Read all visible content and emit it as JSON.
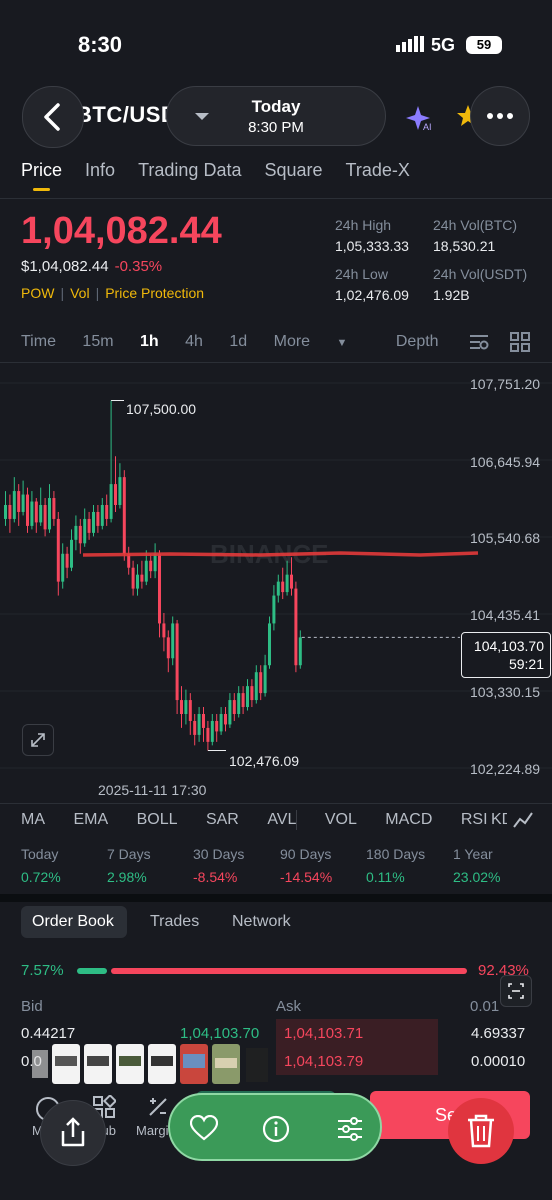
{
  "status_bar": {
    "time": "8:30",
    "network": "5G",
    "battery": "59"
  },
  "header": {
    "pair": "BTC/USDT",
    "today_title": "Today",
    "today_time": "8:30 PM"
  },
  "tabs": [
    "Price",
    "Info",
    "Trading Data",
    "Square",
    "Trade-X"
  ],
  "price": {
    "last": "1,04,082.44",
    "usd": "$1,04,082.44",
    "change": "-0.35%",
    "tags": [
      "POW",
      "Vol",
      "Price Protection"
    ]
  },
  "stats": {
    "high_label": "24h High",
    "high": "1,05,333.33",
    "vol_btc_label": "24h Vol(BTC)",
    "vol_btc": "18,530.21",
    "low_label": "24h Low",
    "low": "1,02,476.09",
    "vol_usdt_label": "24h Vol(USDT)",
    "vol_usdt": "1.92B"
  },
  "intervals": [
    "Time",
    "15m",
    "1h",
    "4h",
    "1d",
    "More",
    "Depth"
  ],
  "chart_data": {
    "type": "candlestick",
    "y_ticks": [
      "107,751.20",
      "106,645.94",
      "105,540.68",
      "104,435.41",
      "103,330.15",
      "102,224.89"
    ],
    "ylim": [
      102224.89,
      107751.2
    ],
    "high_marker": "107,500.00",
    "low_marker": "102,476.09",
    "current_price": "104,103.70",
    "countdown": "59:21",
    "x_label": "2025-11-11 17:30",
    "watermark": "BINANCE",
    "candles": [
      {
        "o": 105800,
        "c": 106000,
        "h": 106200,
        "l": 105700
      },
      {
        "o": 106000,
        "c": 105800,
        "h": 106150,
        "l": 105600
      },
      {
        "o": 105800,
        "c": 106200,
        "h": 106400,
        "l": 105750
      },
      {
        "o": 106200,
        "c": 105900,
        "h": 106300,
        "l": 105700
      },
      {
        "o": 105900,
        "c": 106150,
        "h": 106350,
        "l": 105850
      },
      {
        "o": 106150,
        "c": 105700,
        "h": 106250,
        "l": 105600
      },
      {
        "o": 105700,
        "c": 106050,
        "h": 106200,
        "l": 105650
      },
      {
        "o": 106050,
        "c": 105750,
        "h": 106100,
        "l": 105600
      },
      {
        "o": 105750,
        "c": 106000,
        "h": 106250,
        "l": 105700
      },
      {
        "o": 106000,
        "c": 105650,
        "h": 106100,
        "l": 105550
      },
      {
        "o": 105650,
        "c": 106100,
        "h": 106300,
        "l": 105600
      },
      {
        "o": 106100,
        "c": 105800,
        "h": 106200,
        "l": 105700
      },
      {
        "o": 105800,
        "c": 104900,
        "h": 105900,
        "l": 104700
      },
      {
        "o": 104900,
        "c": 105300,
        "h": 105450,
        "l": 104800
      },
      {
        "o": 105300,
        "c": 105100,
        "h": 105400,
        "l": 104950
      },
      {
        "o": 105100,
        "c": 105500,
        "h": 105650,
        "l": 105050
      },
      {
        "o": 105500,
        "c": 105700,
        "h": 105850,
        "l": 105350
      },
      {
        "o": 105700,
        "c": 105450,
        "h": 105800,
        "l": 105300
      },
      {
        "o": 105450,
        "c": 105800,
        "h": 105950,
        "l": 105400
      },
      {
        "o": 105800,
        "c": 105600,
        "h": 105900,
        "l": 105500
      },
      {
        "o": 105600,
        "c": 105900,
        "h": 106000,
        "l": 105550
      },
      {
        "o": 105900,
        "c": 105700,
        "h": 106000,
        "l": 105600
      },
      {
        "o": 105700,
        "c": 106000,
        "h": 106100,
        "l": 105650
      },
      {
        "o": 106000,
        "c": 105800,
        "h": 106150,
        "l": 105700
      },
      {
        "o": 105800,
        "c": 106300,
        "h": 107500,
        "l": 105750
      },
      {
        "o": 106300,
        "c": 106000,
        "h": 106700,
        "l": 105900
      },
      {
        "o": 106000,
        "c": 106400,
        "h": 106600,
        "l": 105950
      },
      {
        "o": 106400,
        "c": 105300,
        "h": 106500,
        "l": 105200
      },
      {
        "o": 105300,
        "c": 105100,
        "h": 105400,
        "l": 105000
      },
      {
        "o": 105100,
        "c": 104800,
        "h": 105200,
        "l": 104700
      },
      {
        "o": 104800,
        "c": 105000,
        "h": 105150,
        "l": 104700
      },
      {
        "o": 105000,
        "c": 104900,
        "h": 105200,
        "l": 104800
      },
      {
        "o": 104900,
        "c": 105200,
        "h": 105350,
        "l": 104850
      },
      {
        "o": 105200,
        "c": 105050,
        "h": 105300,
        "l": 104950
      },
      {
        "o": 105050,
        "c": 105300,
        "h": 105450,
        "l": 104950
      },
      {
        "o": 105300,
        "c": 104300,
        "h": 105350,
        "l": 104100
      },
      {
        "o": 104300,
        "c": 104100,
        "h": 104450,
        "l": 103900
      },
      {
        "o": 104100,
        "c": 103800,
        "h": 104200,
        "l": 103600
      },
      {
        "o": 103800,
        "c": 104300,
        "h": 104400,
        "l": 103700
      },
      {
        "o": 104300,
        "c": 103200,
        "h": 104350,
        "l": 103000
      },
      {
        "o": 103200,
        "c": 103000,
        "h": 103400,
        "l": 102800
      },
      {
        "o": 103000,
        "c": 103200,
        "h": 103350,
        "l": 102850
      },
      {
        "o": 103200,
        "c": 102900,
        "h": 103300,
        "l": 102700
      },
      {
        "o": 102900,
        "c": 102700,
        "h": 103000,
        "l": 102550
      },
      {
        "o": 102700,
        "c": 103000,
        "h": 103100,
        "l": 102600
      },
      {
        "o": 103000,
        "c": 102800,
        "h": 103100,
        "l": 102600
      },
      {
        "o": 102800,
        "c": 102600,
        "h": 102900,
        "l": 102476
      },
      {
        "o": 102600,
        "c": 102900,
        "h": 103000,
        "l": 102550
      },
      {
        "o": 102900,
        "c": 102750,
        "h": 103000,
        "l": 102600
      },
      {
        "o": 102750,
        "c": 103000,
        "h": 103100,
        "l": 102700
      },
      {
        "o": 103000,
        "c": 102850,
        "h": 103100,
        "l": 102750
      },
      {
        "o": 102850,
        "c": 103200,
        "h": 103300,
        "l": 102800
      },
      {
        "o": 103200,
        "c": 103000,
        "h": 103300,
        "l": 102900
      },
      {
        "o": 103000,
        "c": 103300,
        "h": 103400,
        "l": 102950
      },
      {
        "o": 103300,
        "c": 103100,
        "h": 103400,
        "l": 103000
      },
      {
        "o": 103100,
        "c": 103400,
        "h": 103500,
        "l": 103050
      },
      {
        "o": 103400,
        "c": 103200,
        "h": 103500,
        "l": 103100
      },
      {
        "o": 103200,
        "c": 103600,
        "h": 103700,
        "l": 103150
      },
      {
        "o": 103600,
        "c": 103300,
        "h": 103700,
        "l": 103200
      },
      {
        "o": 103300,
        "c": 103700,
        "h": 103850,
        "l": 103250
      },
      {
        "o": 103700,
        "c": 104300,
        "h": 104400,
        "l": 103650
      },
      {
        "o": 104300,
        "c": 104700,
        "h": 104850,
        "l": 104200
      },
      {
        "o": 104700,
        "c": 104900,
        "h": 105000,
        "l": 104600
      },
      {
        "o": 104900,
        "c": 104750,
        "h": 105100,
        "l": 104650
      },
      {
        "o": 104750,
        "c": 105000,
        "h": 105200,
        "l": 104700
      },
      {
        "o": 105000,
        "c": 104800,
        "h": 105250,
        "l": 104700
      },
      {
        "o": 104800,
        "c": 103700,
        "h": 104900,
        "l": 103600
      },
      {
        "o": 103700,
        "c": 104100,
        "h": 104200,
        "l": 103650
      }
    ]
  },
  "indicators": [
    "MA",
    "EMA",
    "BOLL",
    "SAR",
    "AVL",
    "VOL",
    "MACD",
    "RSI",
    "KDJ"
  ],
  "performance": [
    {
      "label": "Today",
      "value": "0.72%",
      "dir": "pos"
    },
    {
      "label": "7 Days",
      "value": "2.98%",
      "dir": "pos"
    },
    {
      "label": "30 Days",
      "value": "-8.54%",
      "dir": "neg"
    },
    {
      "label": "90 Days",
      "value": "-14.54%",
      "dir": "neg"
    },
    {
      "label": "180 Days",
      "value": "0.11%",
      "dir": "pos"
    },
    {
      "label": "1 Year",
      "value": "23.02%",
      "dir": "pos"
    }
  ],
  "orderbook": {
    "tabs": [
      "Order Book",
      "Trades",
      "Network"
    ],
    "buy_pct": "7.57%",
    "sell_pct": "92.43%",
    "buy_fraction": 0.0757,
    "bid_label": "Bid",
    "ask_label": "Ask",
    "precision": "0.01",
    "rows": [
      {
        "bid_qty": "0.44217",
        "bid_price": "1,04,103.70",
        "ask_price": "1,04,103.71",
        "ask_qty": "4.69337"
      },
      {
        "bid_qty": "0.0",
        "bid_price": "",
        "ask_price": "1,04,103.79",
        "ask_qty": "0.00010"
      }
    ]
  },
  "bottom": {
    "markets": "Markets",
    "hub": "Hub",
    "margin": "Margin",
    "sell": "Sell"
  }
}
